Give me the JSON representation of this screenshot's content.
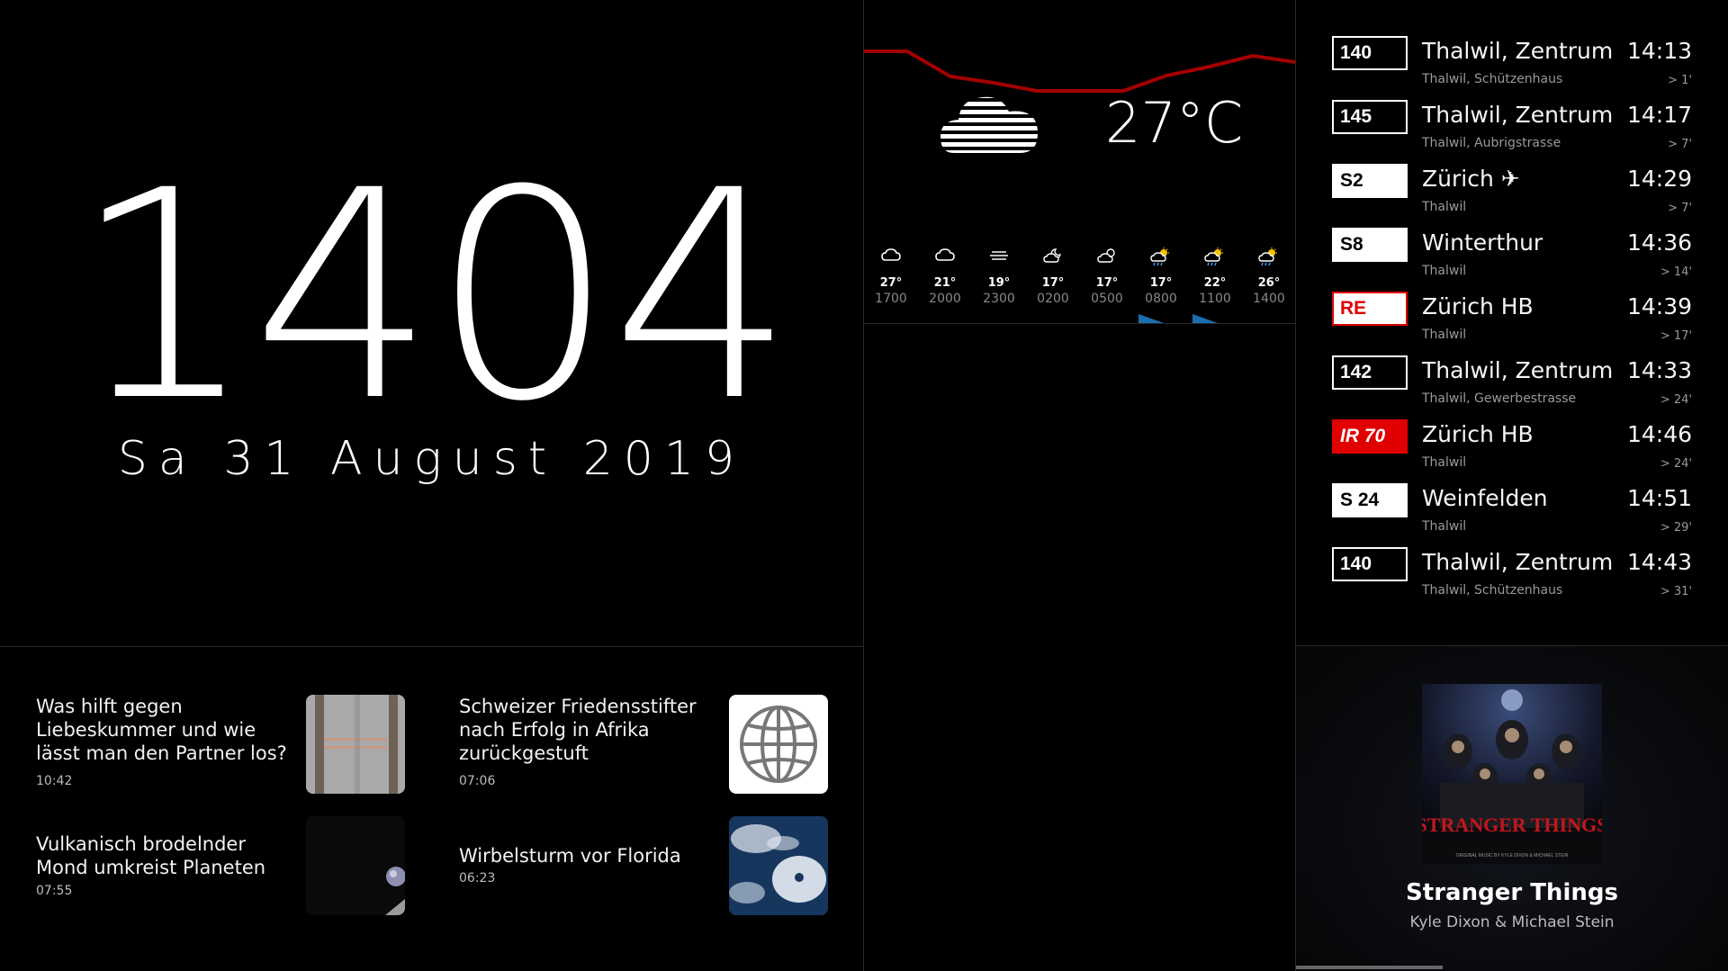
{
  "clock": {
    "time": "1404",
    "date": "Sa 31 August 2019"
  },
  "weather": {
    "current_temp": "27°C",
    "current_icon": "fog-cloud-icon",
    "forecast": [
      {
        "temp": "27°",
        "hour": "1700",
        "icon": "cloud-icon"
      },
      {
        "temp": "21°",
        "hour": "2000",
        "icon": "cloud-icon"
      },
      {
        "temp": "19°",
        "hour": "2300",
        "icon": "fog-icon"
      },
      {
        "temp": "17°",
        "hour": "0200",
        "icon": "cloud-moon-icon"
      },
      {
        "temp": "17°",
        "hour": "0500",
        "icon": "cloud-sun-icon"
      },
      {
        "temp": "17°",
        "hour": "0800",
        "icon": "sun-rain-icon"
      },
      {
        "temp": "22°",
        "hour": "1100",
        "icon": "sun-rain-icon"
      },
      {
        "temp": "26°",
        "hour": "1400",
        "icon": "sun-rain-icon"
      }
    ],
    "colors": {
      "temp_line": "#b00000",
      "rain": "#1a6fb0"
    }
  },
  "departures": [
    {
      "line": "140",
      "style": "black",
      "dest": "Thalwil, Zentrum",
      "stop": "Thalwil, Schützenhaus",
      "time": "14:13",
      "delay": "> 1'"
    },
    {
      "line": "145",
      "style": "black",
      "dest": "Thalwil, Zentrum",
      "stop": "Thalwil, Aubrigstrasse",
      "time": "14:17",
      "delay": "> 7'"
    },
    {
      "line": "S2",
      "style": "white",
      "dest": "Zürich ✈",
      "stop": "Thalwil",
      "time": "14:29",
      "delay": "> 7'"
    },
    {
      "line": "S8",
      "style": "white",
      "dest": "Winterthur",
      "stop": "Thalwil",
      "time": "14:36",
      "delay": "> 14'"
    },
    {
      "line": "RE",
      "style": "re",
      "dest": "Zürich HB",
      "stop": "Thalwil",
      "time": "14:39",
      "delay": "> 17'"
    },
    {
      "line": "142",
      "style": "black",
      "dest": "Thalwil, Zentrum",
      "stop": "Thalwil, Gewerbestrasse",
      "time": "14:33",
      "delay": "> 24'"
    },
    {
      "line": "IR 70",
      "style": "ir",
      "dest": "Zürich HB",
      "stop": "Thalwil",
      "time": "14:46",
      "delay": "> 24'"
    },
    {
      "line": "S 24",
      "style": "white",
      "dest": "Weinfelden",
      "stop": "Thalwil",
      "time": "14:51",
      "delay": "> 29'"
    },
    {
      "line": "140",
      "style": "black",
      "dest": "Thalwil, Zentrum",
      "stop": "Thalwil, Schützenhaus",
      "time": "14:43",
      "delay": "> 31'"
    }
  ],
  "news": [
    {
      "title": "Was hilft gegen Liebeskummer und wie lässt man den Partner los?",
      "time": "10:42",
      "thumb": "couple-feet-photo"
    },
    {
      "title": "Schweizer Friedensstifter nach Erfolg in Afrika zurückgestuft",
      "time": "07:06",
      "thumb": "globe-icon"
    },
    {
      "title": "Vulkanisch brodelnder Mond umkreist Planeten",
      "time": "07:55",
      "thumb": "space-planet-photo"
    },
    {
      "title": "Wirbelsturm vor Florida",
      "time": "06:23",
      "thumb": "hurricane-satellite-photo"
    }
  ],
  "music": {
    "title": "Stranger Things",
    "artist": "Kyle Dixon & Michael Stein",
    "album_art_text": "STRANGER THINGS",
    "progress": 0.34
  }
}
